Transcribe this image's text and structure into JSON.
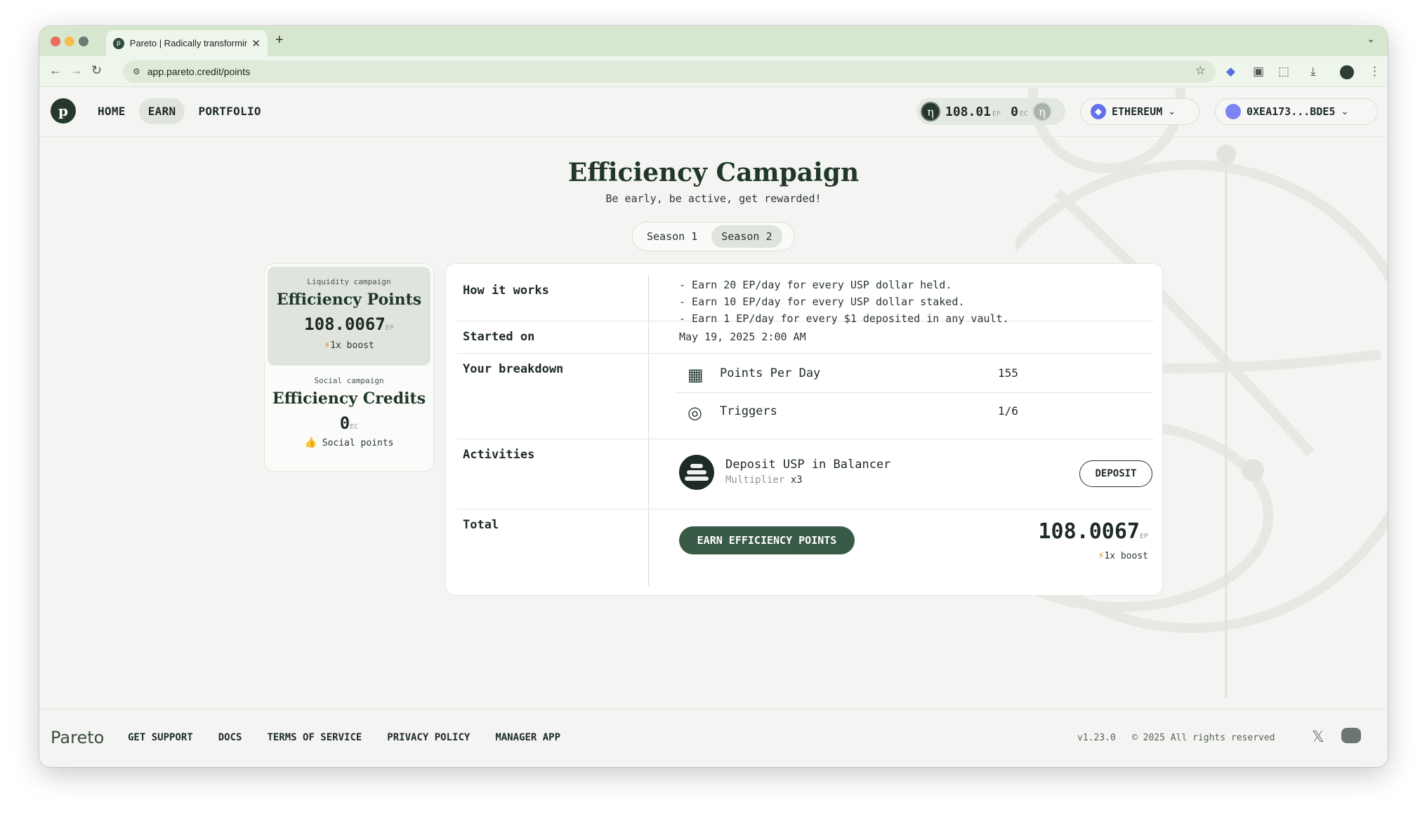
{
  "browser": {
    "tab_title": "Pareto | Radically transformin",
    "url": "app.pareto.credit/points"
  },
  "header": {
    "nav": [
      "HOME",
      "EARN",
      "PORTFOLIO"
    ],
    "active_nav": "EARN",
    "ep_value": "108.01",
    "ep_unit": "EP",
    "ec_value": "0",
    "ec_unit": "EC",
    "chain": "ETHEREUM",
    "wallet": "0XEA173...BDE5"
  },
  "hero": {
    "title": "Efficiency Campaign",
    "subtitle": "Be early, be active, get rewarded!",
    "seasons": [
      "Season 1",
      "Season 2"
    ],
    "active_season": "Season 2"
  },
  "cards": [
    {
      "caption": "Liquidity campaign",
      "title": "Efficiency Points",
      "value": "108.0067",
      "unit": "EP",
      "footer": "1x boost"
    },
    {
      "caption": "Social campaign",
      "title": "Efficiency Credits",
      "value": "0",
      "unit": "EC",
      "footer": "Social points"
    }
  ],
  "panel": {
    "how_it_works": {
      "label": "How it works",
      "lines": [
        "- Earn 20 EP/day for every USP dollar held.",
        "- Earn 10 EP/day for every USP dollar staked.",
        "- Earn 1 EP/day for every $1 deposited in any vault."
      ]
    },
    "started_on": {
      "label": "Started on",
      "value": "May 19, 2025 2:00 AM"
    },
    "breakdown": {
      "label": "Your breakdown",
      "items": [
        {
          "label": "Points Per Day",
          "value": "155",
          "icon": "calendar-icon"
        },
        {
          "label": "Triggers",
          "value": "1/6",
          "icon": "target-icon"
        }
      ]
    },
    "activities": {
      "label": "Activities",
      "title": "Deposit USP in Balancer",
      "multiplier_label": "Multiplier",
      "multiplier_value": "x3",
      "button": "DEPOSIT"
    },
    "total": {
      "label": "Total",
      "button": "EARN EFFICIENCY POINTS",
      "value": "108.0067",
      "unit": "EP",
      "boost": "1x boost"
    }
  },
  "footer": {
    "logo": "Pareto",
    "links": [
      "GET SUPPORT",
      "DOCS",
      "TERMS OF SERVICE",
      "PRIVACY POLICY",
      "MANAGER APP"
    ],
    "version": "v1.23.0",
    "rights": "2025 All rights reserved"
  },
  "colors": {
    "brand_dark": "#22372c",
    "accent_green": "#3a5a48",
    "boost": "#e7852d",
    "chrome": "#d7e6cf"
  }
}
